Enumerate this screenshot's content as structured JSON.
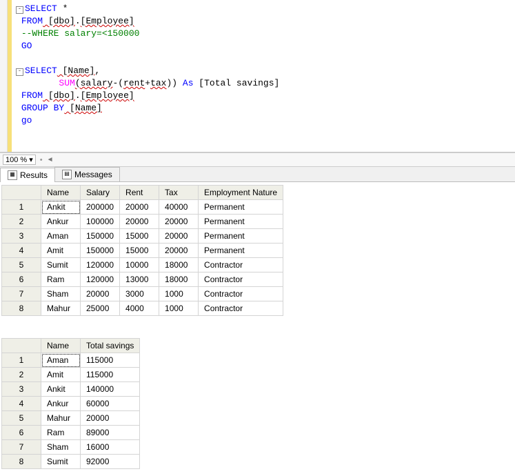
{
  "zoom": {
    "percent": "100 %"
  },
  "sql": {
    "l1a": "SELECT",
    "l1b": " *",
    "l2a": "FROM",
    "l2b": " [dbo]",
    "l2c": ".",
    "l2d": "[Employee]",
    "l3": "--WHERE salary=<150000",
    "l4": "GO",
    "l6a": "SELECT",
    "l6b": " [Name]",
    "l6c": ",",
    "l7a": "SUM",
    "l7b": "(salary",
    "l7c": "-(",
    "l7d": "rent",
    "l7e": "+",
    "l7f": "tax",
    "l7g": ")) ",
    "l7h": "As",
    "l7i": " [Total savings]",
    "l8a": "FROM",
    "l8b": " [dbo]",
    "l8c": ".",
    "l8d": "[Employee]",
    "l9a": "GROUP",
    "l9b": " BY",
    "l9c": " [Name]",
    "l10": "go"
  },
  "tabs": {
    "results": "Results",
    "messages": "Messages"
  },
  "grid1": {
    "headers": [
      "",
      "Name",
      "Salary",
      "Rent",
      "Tax",
      "Employment Nature"
    ],
    "rows": [
      [
        "1",
        "Ankit",
        "200000",
        "20000",
        "40000",
        "Permanent"
      ],
      [
        "2",
        "Ankur",
        "100000",
        "20000",
        "20000",
        "Permanent"
      ],
      [
        "3",
        "Aman",
        "150000",
        "15000",
        "20000",
        "Permanent"
      ],
      [
        "4",
        "Amit",
        "150000",
        "15000",
        "20000",
        "Permanent"
      ],
      [
        "5",
        "Sumit",
        "120000",
        "10000",
        "18000",
        "Contractor"
      ],
      [
        "6",
        "Ram",
        "120000",
        "13000",
        "18000",
        "Contractor"
      ],
      [
        "7",
        "Sham",
        "20000",
        "3000",
        "1000",
        "Contractor"
      ],
      [
        "8",
        "Mahur",
        "25000",
        "4000",
        "1000",
        "Contractor"
      ]
    ]
  },
  "grid2": {
    "headers": [
      "",
      "Name",
      "Total savings"
    ],
    "rows": [
      [
        "1",
        "Aman",
        "115000"
      ],
      [
        "2",
        "Amit",
        "115000"
      ],
      [
        "3",
        "Ankit",
        "140000"
      ],
      [
        "4",
        "Ankur",
        "60000"
      ],
      [
        "5",
        "Mahur",
        "20000"
      ],
      [
        "6",
        "Ram",
        "89000"
      ],
      [
        "7",
        "Sham",
        "16000"
      ],
      [
        "8",
        "Sumit",
        "92000"
      ]
    ]
  }
}
